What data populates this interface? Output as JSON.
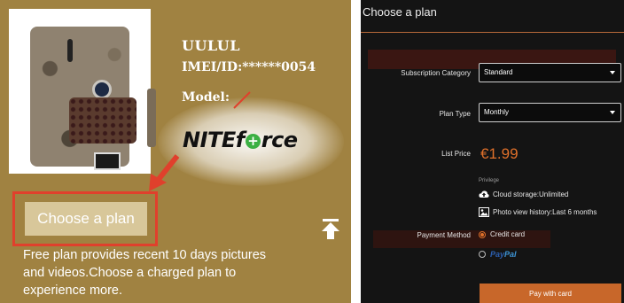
{
  "left_panel": {
    "device_name": "UULUL",
    "imei": "IMEI/ID:******0054",
    "model_label": "Model:",
    "brand_logo": "NITEforce",
    "choose_plan_button": "Choose a plan",
    "free_plan_text": "Free plan provides recent 10 days pictures and videos.Choose a charged plan to experience more.",
    "icons": [
      "upload-icon"
    ],
    "colors": {
      "panel_bg": "#a08241",
      "button_bg": "#d8c79a",
      "highlight": "#e0402c"
    }
  },
  "right_panel": {
    "title": "Choose a plan",
    "subscription_category": {
      "label": "Subscription Category",
      "value": "Standard"
    },
    "plan_type": {
      "label": "Plan Type",
      "value": "Monthly"
    },
    "list_price": {
      "label": "List Price",
      "value": "€1.99"
    },
    "privilege_label": "Privilege",
    "privileges": [
      {
        "icon": "cloud-icon",
        "text": "Cloud storage:Unlimited"
      },
      {
        "icon": "image-icon",
        "text": "Photo view history:Last 6 months"
      }
    ],
    "payment_method": {
      "label": "Payment Method",
      "options": [
        {
          "text": "Credit card",
          "selected": true
        },
        {
          "text": "PayPal",
          "selected": false
        }
      ]
    },
    "pay_button": "Pay with card",
    "colors": {
      "panel_bg": "#141414",
      "accent": "#e0702a"
    }
  }
}
